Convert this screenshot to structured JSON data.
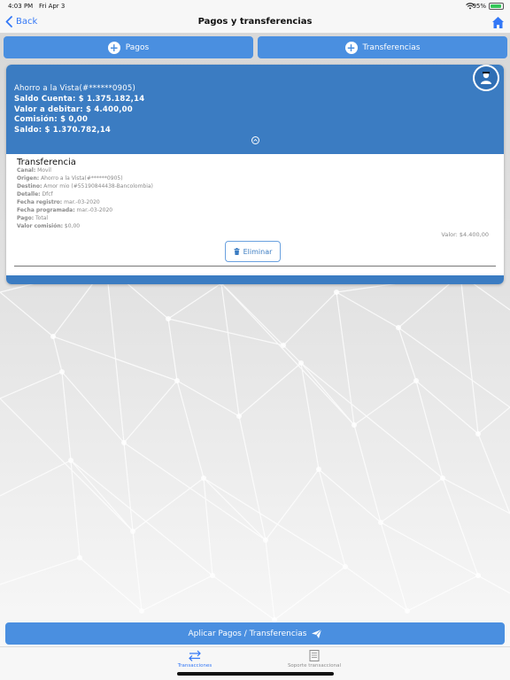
{
  "status_bar": {
    "time": "4:03 PM",
    "date": "Fri Apr 3",
    "battery": "95%",
    "battery_level": 0.95
  },
  "nav": {
    "back_label": "Back",
    "title": "Pagos y transferencias",
    "home_icon": "home-icon"
  },
  "actions": {
    "pagos_label": "Pagos",
    "transferencias_label": "Transferencias"
  },
  "account": {
    "name": "Ahorro a la Vista(#******0905)",
    "saldo_cuenta": "Saldo Cuenta: $ 1.375.182,14",
    "valor_debitar": "Valor a debitar: $ 4.400,00",
    "comision": "Comisión: $ 0,00",
    "saldo": "Saldo: $ 1.370.782,14"
  },
  "transaction": {
    "title": "Transferencia",
    "fields": [
      {
        "label": "Canal:",
        "value": "Movil"
      },
      {
        "label": "Origen:",
        "value": "Ahorro a la Vista(#******0905)"
      },
      {
        "label": "Destino:",
        "value": "Amor mio (#55190844438-Bancolombia)"
      },
      {
        "label": "Detalle:",
        "value": "Dfcf"
      },
      {
        "label": "Fecha registro:",
        "value": "mar.-03-2020"
      },
      {
        "label": "Fecha programada:",
        "value": "mar.-03-2020"
      },
      {
        "label": "Pago:",
        "value": "Total"
      },
      {
        "label": "Valor comisión:",
        "value": "$0,00"
      }
    ],
    "valor": "Valor: $4.400,00",
    "delete_label": "Eliminar"
  },
  "apply_label": "Aplicar Pagos / Transferencias",
  "tabs": [
    {
      "label": "Transacciones",
      "active": true
    },
    {
      "label": "Soporte transaccional",
      "active": false
    }
  ],
  "colors": {
    "accent": "#3478f6",
    "primary": "#3b7cc2",
    "button": "#4a8fe0"
  }
}
